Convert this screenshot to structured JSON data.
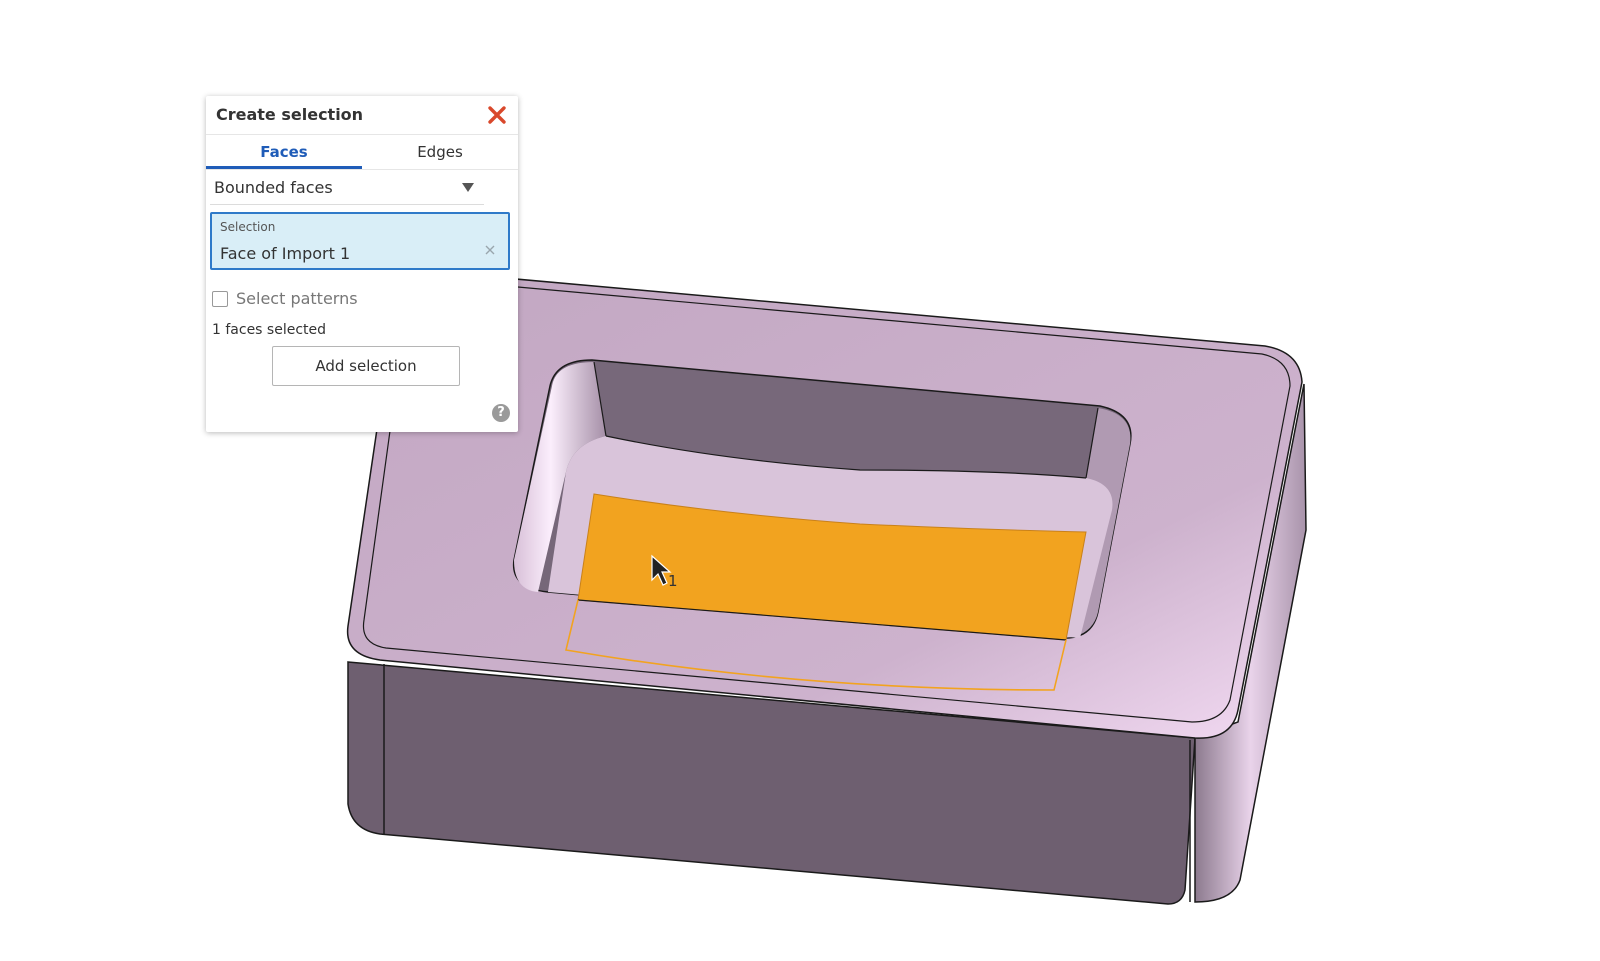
{
  "panel": {
    "title": "Create selection",
    "close_icon": "close-icon",
    "tabs": [
      {
        "label": "Faces",
        "active": true
      },
      {
        "label": "Edges",
        "active": false
      }
    ],
    "dropdown": {
      "value": "Bounded faces",
      "icon": "chevron-down-icon"
    },
    "selection": {
      "label": "Selection",
      "value": "Face of Import 1",
      "clear_icon": "clear-icon"
    },
    "select_patterns": {
      "label": "Select patterns",
      "checked": false
    },
    "count_text": "1 faces selected",
    "add_button_label": "Add selection",
    "help_icon": "?"
  },
  "viewport": {
    "cursor_badge": "1"
  },
  "colors": {
    "accent": "#1f5cb8",
    "close": "#d9482b",
    "highlight": "#f2a31f",
    "model_top": "#c6aac6",
    "model_side": "#6e5f70",
    "pocket_wall": "#7a6a7c"
  }
}
